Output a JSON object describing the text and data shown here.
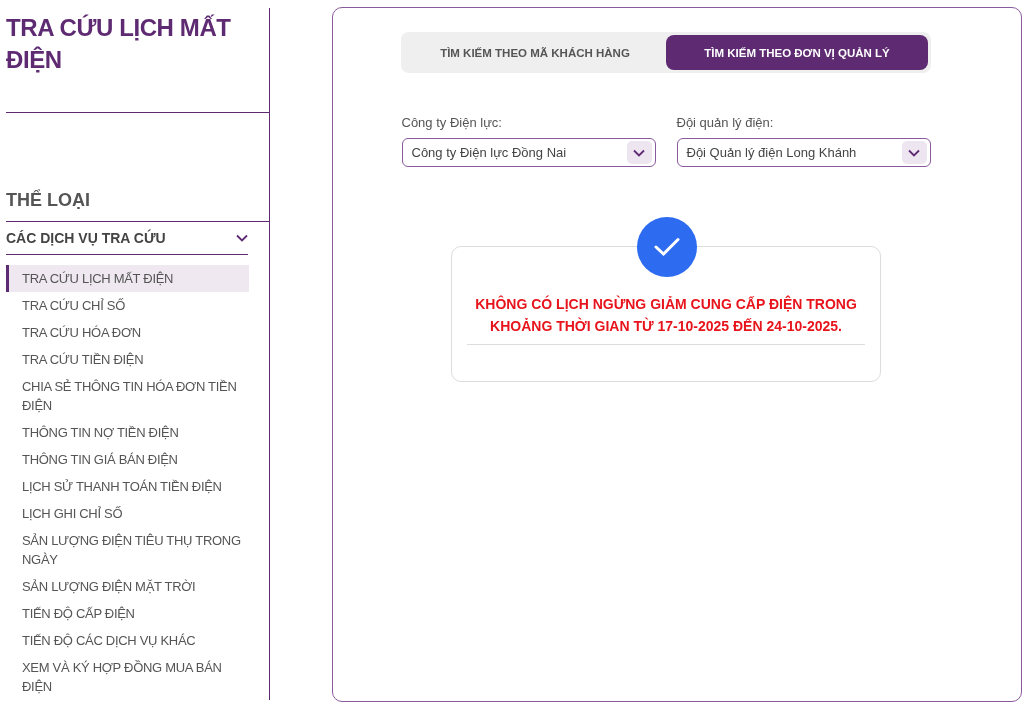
{
  "sidebar": {
    "title": "TRA CỨU LỊCH MẤT ĐIỆN",
    "category_heading": "THỂ LOẠI",
    "group": {
      "label": "CÁC DỊCH VỤ TRA CỨU",
      "expanded": true,
      "items": [
        {
          "label": "TRA CỨU LỊCH MẤT ĐIỆN",
          "selected": true
        },
        {
          "label": "TRA CỨU CHỈ SỐ",
          "selected": false
        },
        {
          "label": "TRA CỨU HÓA ĐƠN",
          "selected": false
        },
        {
          "label": "TRA CỨU TIỀN ĐIỆN",
          "selected": false
        },
        {
          "label": "CHIA SẺ THÔNG TIN HÓA ĐƠN TIỀN ĐIỆN",
          "selected": false
        },
        {
          "label": "THÔNG TIN NỢ TIỀN ĐIỆN",
          "selected": false
        },
        {
          "label": "THÔNG TIN GIÁ BÁN ĐIỆN",
          "selected": false
        },
        {
          "label": "LỊCH SỬ THANH TOÁN TIỀN ĐIỆN",
          "selected": false
        },
        {
          "label": "LỊCH GHI CHỈ SỐ",
          "selected": false
        },
        {
          "label": "SẢN LƯỢNG ĐIỆN TIÊU THỤ TRONG NGÀY",
          "selected": false
        },
        {
          "label": "SẢN LƯỢNG ĐIỆN MẶT TRỜI",
          "selected": false
        },
        {
          "label": "TIẾN ĐỘ CẤP ĐIỆN",
          "selected": false
        },
        {
          "label": "TIẾN ĐỘ CÁC DỊCH VỤ KHÁC",
          "selected": false
        },
        {
          "label": "XEM VÀ KÝ HỢP ĐỒNG MUA BÁN ĐIỆN",
          "selected": false
        }
      ]
    }
  },
  "tabs": [
    {
      "label": "TÌM KIẾM THEO MÃ KHÁCH HÀNG",
      "selected": false
    },
    {
      "label": "TÌM KIẾM THEO ĐƠN VỊ QUẢN LÝ",
      "selected": true
    }
  ],
  "selects": [
    {
      "label": "Công ty Điện lực:",
      "value": "Công ty Điện lực Đồng Nai"
    },
    {
      "label": "Đội quản lý điện:",
      "value": "Đội Quản lý điện Long Khánh"
    }
  ],
  "result": {
    "message": "KHÔNG CÓ LỊCH NGỪNG GIẢM CUNG CẤP ĐIỆN TRONG KHOẢNG THỜI GIAN TỪ 17-10-2025 ĐẾN 24-10-2025."
  }
}
